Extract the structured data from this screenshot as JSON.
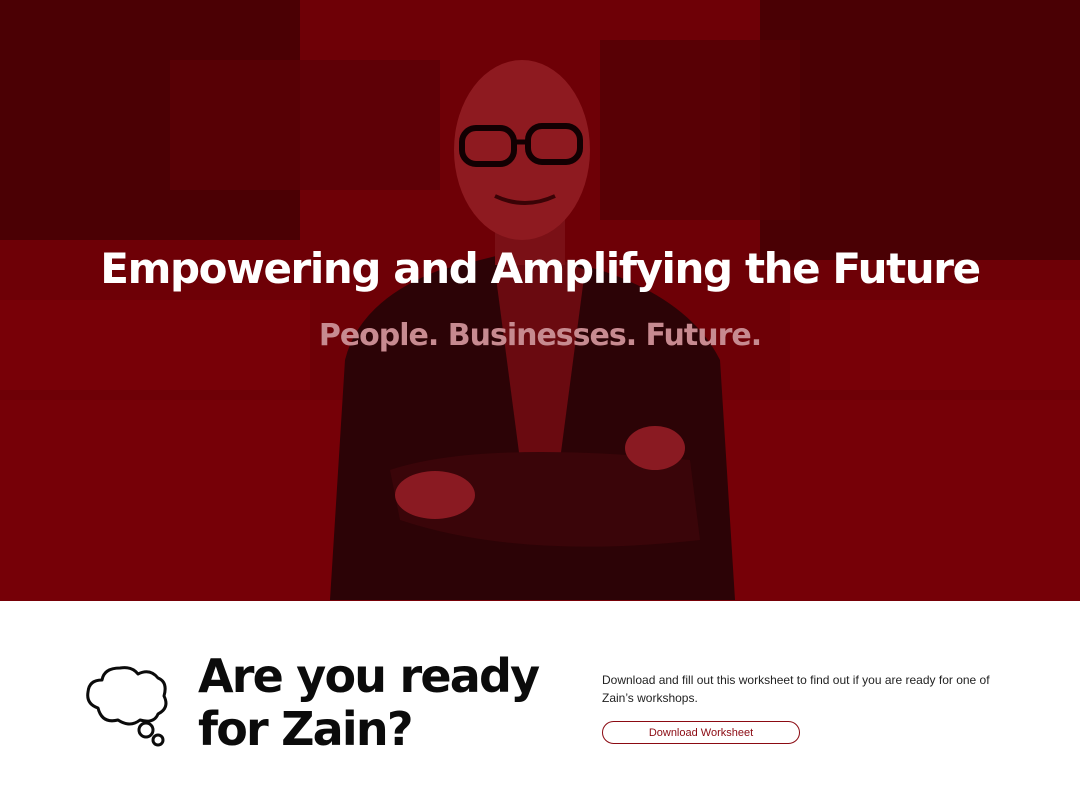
{
  "hero": {
    "title": "Empowering and Amplifying the Future",
    "subtitle": "People. Businesses. Future.",
    "overlay_color": "#8a0008",
    "subtitle_color": "#c78a90"
  },
  "cta": {
    "heading_line1": "Are you ready",
    "heading_line2": "for Zain?",
    "description": "Download and fill out this worksheet to find out if you are ready for one of Zain’s workshops.",
    "button_label": "Download Worksheet",
    "icon": "thought-bubble-icon",
    "accent_color": "#8b0a12"
  }
}
